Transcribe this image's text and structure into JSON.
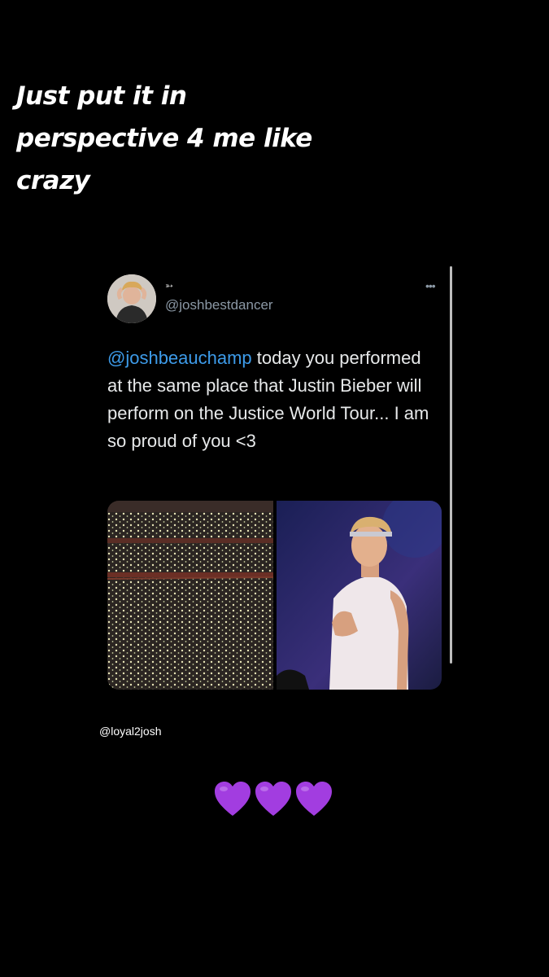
{
  "story": {
    "caption": "Just put it in\nperspective 4 me like\ncrazy",
    "watermark": "@loyal2josh",
    "hearts": [
      "purple-heart",
      "purple-heart",
      "purple-heart"
    ],
    "heart_color": "#a23de0"
  },
  "tweet": {
    "display_name_emoji": "➳",
    "handle": "@joshbestdancer",
    "more_label": "•••",
    "mention": "@joshbeauchamp",
    "body": " today you performed at the same place that Justin Bieber will perform on the Justice World Tour... I am so proud of you <3",
    "mention_color": "#3d9be9",
    "media": [
      "arena-crowd-photo",
      "performer-photo"
    ]
  }
}
